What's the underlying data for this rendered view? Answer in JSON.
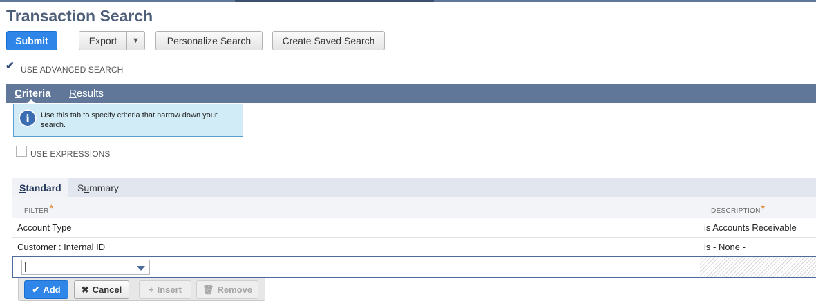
{
  "page": {
    "title": "Transaction Search"
  },
  "toolbar": {
    "submit_label": "Submit",
    "export_label": "Export",
    "export_caret": "▼",
    "personalize_label": "Personalize Search",
    "create_saved_label": "Create Saved Search"
  },
  "advanced_search": {
    "label": "USE ADVANCED SEARCH",
    "checked": true
  },
  "tabs": [
    {
      "accesskey": "C",
      "rest": "riteria",
      "active": true
    },
    {
      "accesskey": "R",
      "rest": "esults",
      "active": false
    }
  ],
  "info": {
    "text": "Use this tab to specify criteria that narrow down your search.",
    "icon": "info-icon"
  },
  "expressions": {
    "label": "USE EXPRESSIONS",
    "checked": false
  },
  "subtabs": [
    {
      "accesskey": "S",
      "rest": "tandard",
      "active": true
    },
    {
      "pre": "S",
      "accesskey": "u",
      "rest": "mmary",
      "active": false
    }
  ],
  "grid": {
    "columns": [
      {
        "label": "FILTER",
        "required_mark": "*"
      },
      {
        "label": "DESCRIPTION",
        "required_mark": "*"
      }
    ],
    "rows": [
      {
        "filter": "Account Type",
        "description": "is Accounts Receivable"
      },
      {
        "filter": "Customer : Internal ID",
        "description": "is - None -"
      }
    ]
  },
  "row_actions": {
    "add_label": "Add",
    "cancel_label": "Cancel",
    "insert_label": "Insert",
    "remove_label": "Remove"
  },
  "colors": {
    "accent": "#2f86e8",
    "tabbar": "#607799",
    "title": "#4d5f79",
    "info_bg": "#d2ecf7",
    "required": "#e27b1b"
  }
}
